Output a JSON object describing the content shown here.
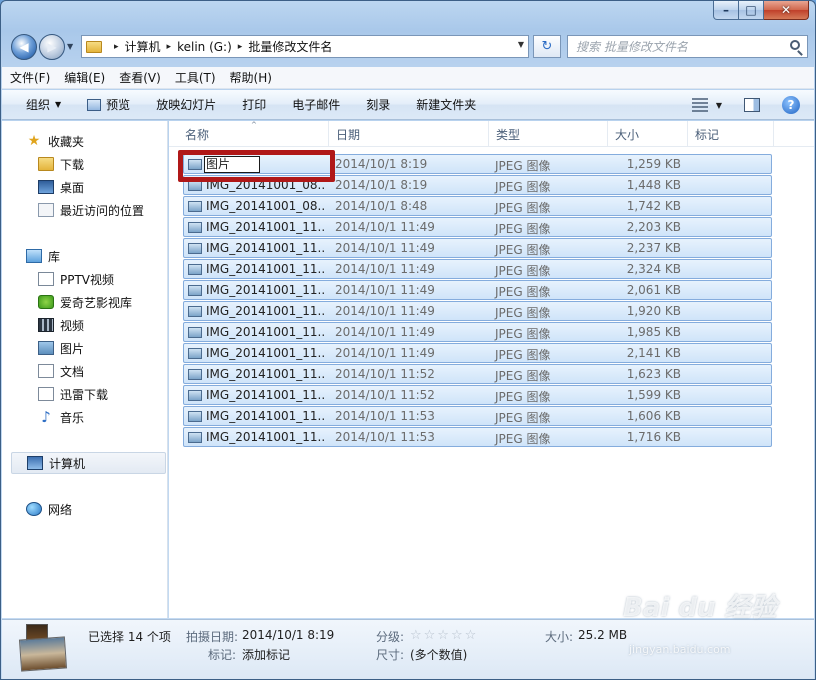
{
  "window": {
    "caption": {
      "minimize_glyph": "–",
      "maximize_glyph": "□",
      "close_glyph": "✕"
    }
  },
  "address": {
    "back_glyph": "◀",
    "forward_glyph": "▶",
    "crumbs": [
      "计算机",
      "kelin (G:)",
      "批量修改文件名"
    ],
    "separator": "▸",
    "dropdown_glyph": "▼",
    "refresh_glyph": "↻"
  },
  "search": {
    "placeholder": "搜索 批量修改文件名"
  },
  "menu": [
    "文件(F)",
    "编辑(E)",
    "查看(V)",
    "工具(T)",
    "帮助(H)"
  ],
  "toolbar": {
    "organize": "组织",
    "preview": "预览",
    "slideshow": "放映幻灯片",
    "print": "打印",
    "email": "电子邮件",
    "burn": "刻录",
    "new_folder": "新建文件夹",
    "dropdown_glyph": "▼",
    "help_glyph": "?"
  },
  "nav": {
    "favorites": "收藏夹",
    "downloads": "下载",
    "desktop": "桌面",
    "recent": "最近访问的位置",
    "libraries": "库",
    "pptv": "PPTV视频",
    "iqiyi": "爱奇艺影视库",
    "videos": "视频",
    "pictures": "图片",
    "documents": "文档",
    "xunlei": "迅雷下载",
    "music": "音乐",
    "computer": "计算机",
    "network": "网络"
  },
  "columns": {
    "name": "名称",
    "date": "日期",
    "type": "类型",
    "size": "大小",
    "tags": "标记",
    "sort_glyph": "^"
  },
  "rename_value": "图片",
  "files": [
    {
      "name": "图片",
      "date": "2014/10/1 8:19",
      "type": "JPEG 图像",
      "size": "1,259 KB"
    },
    {
      "name": "IMG_20141001_08...",
      "date": "2014/10/1 8:19",
      "type": "JPEG 图像",
      "size": "1,448 KB"
    },
    {
      "name": "IMG_20141001_08...",
      "date": "2014/10/1 8:48",
      "type": "JPEG 图像",
      "size": "1,742 KB"
    },
    {
      "name": "IMG_20141001_11...",
      "date": "2014/10/1 11:49",
      "type": "JPEG 图像",
      "size": "2,203 KB"
    },
    {
      "name": "IMG_20141001_11...",
      "date": "2014/10/1 11:49",
      "type": "JPEG 图像",
      "size": "2,237 KB"
    },
    {
      "name": "IMG_20141001_11...",
      "date": "2014/10/1 11:49",
      "type": "JPEG 图像",
      "size": "2,324 KB"
    },
    {
      "name": "IMG_20141001_11...",
      "date": "2014/10/1 11:49",
      "type": "JPEG 图像",
      "size": "2,061 KB"
    },
    {
      "name": "IMG_20141001_11...",
      "date": "2014/10/1 11:49",
      "type": "JPEG 图像",
      "size": "1,920 KB"
    },
    {
      "name": "IMG_20141001_11...",
      "date": "2014/10/1 11:49",
      "type": "JPEG 图像",
      "size": "1,985 KB"
    },
    {
      "name": "IMG_20141001_11...",
      "date": "2014/10/1 11:49",
      "type": "JPEG 图像",
      "size": "2,141 KB"
    },
    {
      "name": "IMG_20141001_11...",
      "date": "2014/10/1 11:52",
      "type": "JPEG 图像",
      "size": "1,623 KB"
    },
    {
      "name": "IMG_20141001_11...",
      "date": "2014/10/1 11:52",
      "type": "JPEG 图像",
      "size": "1,599 KB"
    },
    {
      "name": "IMG_20141001_11...",
      "date": "2014/10/1 11:53",
      "type": "JPEG 图像",
      "size": "1,606 KB"
    },
    {
      "name": "IMG_20141001_11...",
      "date": "2014/10/1 11:53",
      "type": "JPEG 图像",
      "size": "1,716 KB"
    }
  ],
  "details": {
    "selected": "已选择 14 个项",
    "taken_label": "拍摄日期:",
    "taken_value": "2014/10/1 8:19",
    "tags_label": "标记:",
    "tags_value": "添加标记",
    "rating_label": "分级:",
    "rating_stars": "☆☆☆☆☆",
    "size_label": "大小:",
    "size_value": "25.2 MB",
    "dims_label": "尺寸:",
    "dims_value": "(多个数值)"
  },
  "watermark": {
    "logo": "Bai du 经验",
    "url": "jingyan.baidu.com"
  }
}
